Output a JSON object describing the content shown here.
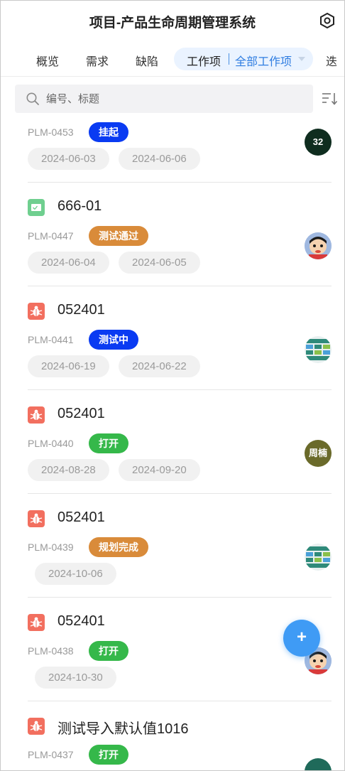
{
  "header": {
    "title": "项目-产品生命周期管理系统",
    "settings_icon": "settings-hexagon-icon"
  },
  "tabs": {
    "items": [
      "概览",
      "需求",
      "缺陷",
      "迭"
    ],
    "active_label": "工作项",
    "active_filter": "全部工作项"
  },
  "search": {
    "placeholder": "编号、标题",
    "icon": "search-icon",
    "sort_icon": "sort-icon"
  },
  "items": [
    {
      "name": "",
      "code": "PLM-0453",
      "status": "挂起",
      "status_color": "#0a3bf2",
      "dates": [
        "2024-06-03",
        "2024-06-06"
      ],
      "avatar_text": "32",
      "avatar_color": "#0f2d1f",
      "icon": ""
    },
    {
      "name": "666-01",
      "code": "PLM-0447",
      "status": "测试通过",
      "status_color": "#d98b3a",
      "dates": [
        "2024-06-04",
        "2024-06-05"
      ],
      "avatar_text": "",
      "avatar_color": "#b4c8e6",
      "icon": "task-icon"
    },
    {
      "name": "052401",
      "code": "PLM-0441",
      "status": "测试中",
      "status_color": "#0a3bf2",
      "dates": [
        "2024-06-19",
        "2024-06-22"
      ],
      "avatar_text": "",
      "avatar_color": "#3a8a6a",
      "icon": "bug-icon"
    },
    {
      "name": "052401",
      "code": "PLM-0440",
      "status": "打开",
      "status_color": "#35b84a",
      "dates": [
        "2024-08-28",
        "2024-09-20"
      ],
      "avatar_text": "周楠",
      "avatar_color": "#6a6a2a",
      "icon": "bug-icon"
    },
    {
      "name": "052401",
      "code": "PLM-0439",
      "status": "规划完成",
      "status_color": "#d98b3a",
      "dates": [
        "2024-10-06"
      ],
      "avatar_text": "",
      "avatar_color": "#3a8a6a",
      "icon": "bug-icon"
    },
    {
      "name": "052401",
      "code": "PLM-0438",
      "status": "打开",
      "status_color": "#35b84a",
      "dates": [
        "2024-10-30"
      ],
      "avatar_text": "",
      "avatar_color": "#b4c8e6",
      "icon": "bug-icon"
    },
    {
      "name": "测试导入默认值1016",
      "code": "PLM-0437",
      "status": "打开",
      "status_color": "#35b84a",
      "dates": [],
      "avatar_text": "",
      "avatar_color": "#1f6a5a",
      "icon": "bug-icon"
    }
  ],
  "fab": {
    "label": "+"
  },
  "colors": {
    "accent": "#2f7de1",
    "bug": "#f26f5f",
    "task": "#6fcf8f"
  }
}
